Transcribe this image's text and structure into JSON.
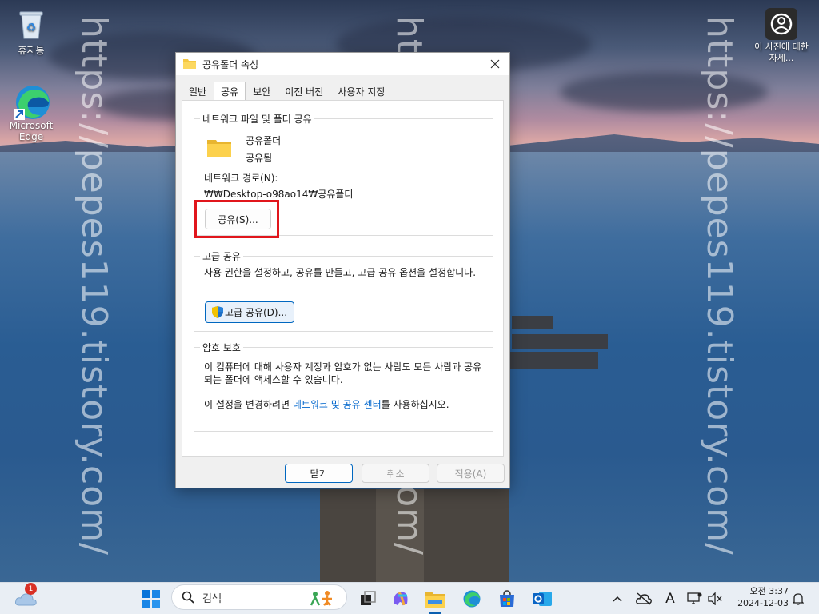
{
  "watermark": "https://pepes119.tistory.com/",
  "desktop": {
    "recycle_bin_label": "휴지통",
    "edge_label": "Microsoft Edge",
    "photo_info_label": "이 사진에 대한 자세..."
  },
  "dialog": {
    "title": "공유폴더 속성",
    "tabs": [
      {
        "label": "일반",
        "active": false
      },
      {
        "label": "공유",
        "active": true
      },
      {
        "label": "보안",
        "active": false
      },
      {
        "label": "이전 버전",
        "active": false
      },
      {
        "label": "사용자 지정",
        "active": false
      }
    ],
    "network_sharing": {
      "group_label": "네트워크 파일 및 폴더 공유",
      "folder_name": "공유폴더",
      "share_status": "공유됨",
      "path_label": "네트워크 경로(N):",
      "path_value": "₩₩Desktop-o98ao14₩공유폴더",
      "share_button": "공유(S)..."
    },
    "advanced_sharing": {
      "group_label": "고급 공유",
      "description": "사용 권한을 설정하고, 공유를 만들고, 고급 공유 옵션을 설정합니다.",
      "button": "고급 공유(D)..."
    },
    "password_protection": {
      "group_label": "암호 보호",
      "description": "이 컴퓨터에 대해 사용자 계정과 암호가 없는 사람도 모든 사람과 공유되는 폴더에 액세스할 수 있습니다.",
      "change_prefix": "이 설정을 변경하려면 ",
      "link_text": "네트워크 및 공유 센터",
      "change_suffix": "를 사용하십시오."
    },
    "buttons": {
      "close": "닫기",
      "cancel": "취소",
      "apply": "적용(A)"
    }
  },
  "taskbar": {
    "weather_badge": "1",
    "search_placeholder": "검색",
    "time": "오전 3:37",
    "date": "2024-12-03",
    "ime_indicator": "A"
  },
  "colors": {
    "accent": "#0067c0",
    "highlight_box": "#e1161c",
    "link": "#0066cc",
    "folder_yellow": "#f5c842"
  }
}
